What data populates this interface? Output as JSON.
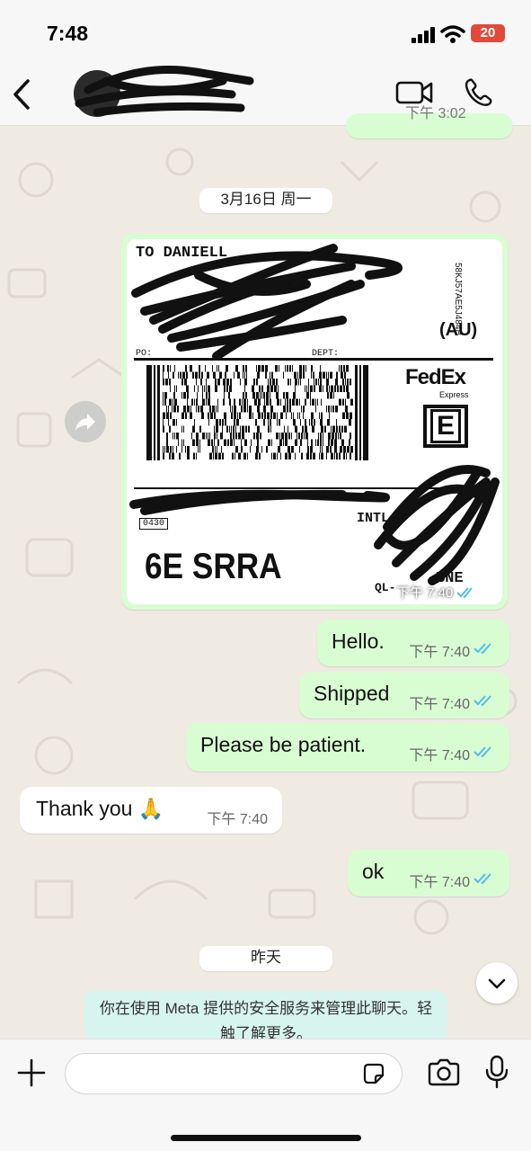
{
  "status_bar": {
    "time": "7:48",
    "battery": "20"
  },
  "header": {
    "back_icon": "chevron-left-icon",
    "video_icon": "video-camera-icon",
    "call_icon": "phone-icon",
    "contact_name": "[redacted]"
  },
  "chat": {
    "top_partial_time": "下午 3:02",
    "date_pill_1": "3月16日 周一",
    "shipping_label": {
      "to_line": "TO DANIELL",
      "country": "(AU)",
      "tracking_side": "58KJ57AE5J484B",
      "dept": "DEPT:",
      "po": "PO:",
      "carrier": "FedEx",
      "carrier_sub": "Express",
      "service_letter": "E",
      "intl": "INTL",
      "code_box": "0430",
      "routing": "6E SRRA",
      "hub": "BNE",
      "ql": "QL-",
      "time": "下午 7:40"
    },
    "messages": [
      {
        "direction": "out",
        "text": "Hello.",
        "time": "下午 7:40"
      },
      {
        "direction": "out",
        "text": "Shipped",
        "time": "下午 7:40"
      },
      {
        "direction": "out",
        "text": "Please be patient.",
        "time": "下午 7:40"
      },
      {
        "direction": "in",
        "text": "Thank you 🙏",
        "time": "下午 7:40"
      },
      {
        "direction": "out",
        "text": "ok",
        "time": "下午 7:40"
      }
    ],
    "date_pill_2": "昨天",
    "system_message": "你在使用 Meta 提供的安全服务来管理此聊天。轻触了解更多。"
  },
  "composer": {
    "placeholder": ""
  },
  "colors": {
    "outgoing_bubble": "#d9fdd3",
    "incoming_bubble": "#ffffff",
    "ticks": "#53bdeb",
    "background": "#efeae2"
  }
}
